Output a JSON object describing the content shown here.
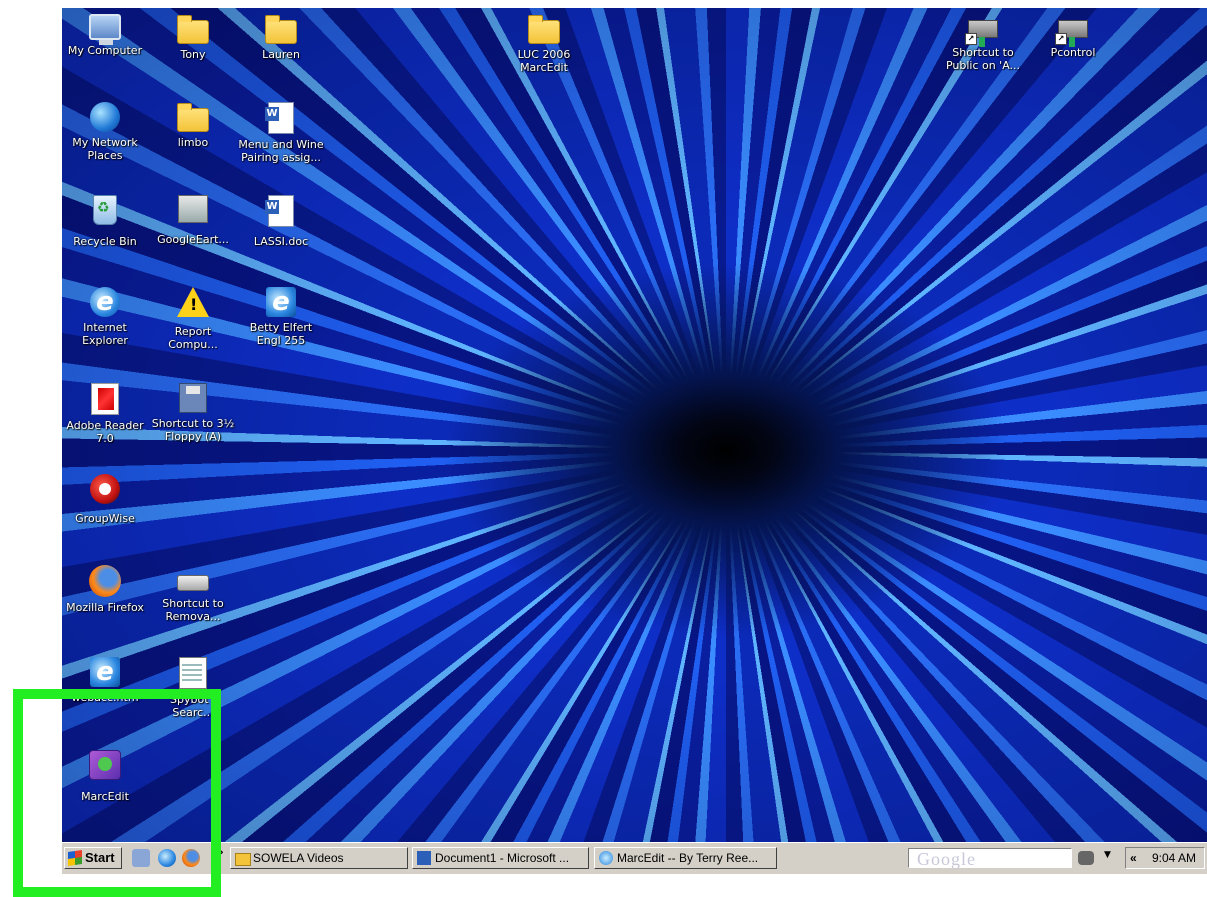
{
  "desktop": {
    "icons": [
      {
        "id": "my-computer",
        "label": "My Computer",
        "icon": "computer-icon"
      },
      {
        "id": "tony",
        "label": "Tony",
        "icon": "folder-icon"
      },
      {
        "id": "lauren",
        "label": "Lauren",
        "icon": "folder-icon"
      },
      {
        "id": "luc-2006",
        "label": "LUC 2006\nMarcEdit",
        "icon": "folder-icon"
      },
      {
        "id": "shortcut-public",
        "label": "Shortcut to\nPublic on 'A...",
        "icon": "network-drive-icon"
      },
      {
        "id": "pcontrol",
        "label": "Pcontrol",
        "icon": "network-icon"
      },
      {
        "id": "my-network-places",
        "label": "My Network\nPlaces",
        "icon": "network-places-icon"
      },
      {
        "id": "limbo",
        "label": "limbo",
        "icon": "folder-icon"
      },
      {
        "id": "menu-wine",
        "label": "Menu and Wine\nPairing assig...",
        "icon": "word-document-icon"
      },
      {
        "id": "recycle-bin",
        "label": "Recycle Bin",
        "icon": "recycle-bin-icon"
      },
      {
        "id": "googleearth",
        "label": "GoogleEart...",
        "icon": "google-earth-icon"
      },
      {
        "id": "lassi",
        "label": "LASSI.doc",
        "icon": "word-document-icon"
      },
      {
        "id": "internet-explorer",
        "label": "Internet\nExplorer",
        "icon": "internet-explorer-icon"
      },
      {
        "id": "report-compu",
        "label": "Report\nCompu...",
        "icon": "warning-icon"
      },
      {
        "id": "betty-elfert",
        "label": "Betty Elfert\nEngl 255",
        "icon": "web-page-icon"
      },
      {
        "id": "adobe-reader",
        "label": "Adobe Reader\n7.0",
        "icon": "adobe-reader-icon"
      },
      {
        "id": "floppy",
        "label": "Shortcut to 3½\nFloppy (A)",
        "icon": "floppy-icon"
      },
      {
        "id": "groupwise",
        "label": "GroupWise",
        "icon": "groupwise-icon"
      },
      {
        "id": "firefox",
        "label": "Mozilla Firefox",
        "icon": "firefox-icon"
      },
      {
        "id": "removable",
        "label": "Shortcut to\nRemova...",
        "icon": "removable-drive-icon"
      },
      {
        "id": "webacc",
        "label": "webacc.htm",
        "icon": "web-page-icon"
      },
      {
        "id": "spybot",
        "label": "Spybot -\nSearc...",
        "icon": "spybot-icon"
      },
      {
        "id": "marcedit",
        "label": "MarcEdit",
        "icon": "marcedit-icon"
      }
    ]
  },
  "taskbar": {
    "start_label": "Start",
    "overflow_chevron": "»",
    "tasks": [
      {
        "label": "SOWELA Videos",
        "icon": "folder-icon"
      },
      {
        "label": "Document1 - Microsoft ...",
        "icon": "word-document-icon"
      },
      {
        "label": "MarcEdit -- By Terry Ree...",
        "icon": "internet-explorer-icon"
      }
    ],
    "google_text": "Google",
    "tray_chevron": "«",
    "clock": "9:04 AM"
  },
  "colors": {
    "highlight": "#22ee22",
    "taskbar": "#d4d0c8",
    "desktop_blue": "#0b20a8"
  }
}
